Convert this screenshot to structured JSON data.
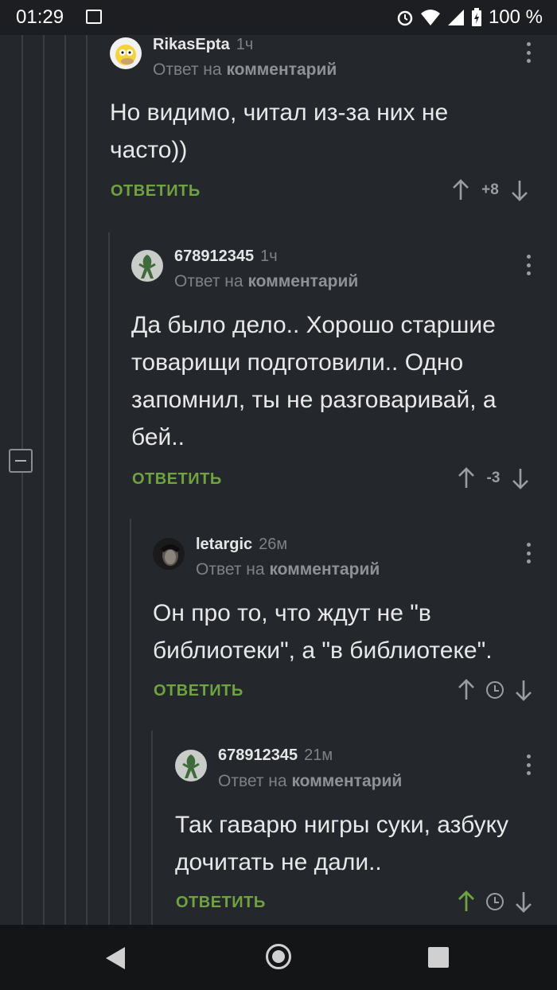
{
  "status_bar": {
    "time": "01:29",
    "battery": "100 %"
  },
  "comments": [
    {
      "username": "RikasEpta",
      "time": "1ч",
      "reply_prefix": "Ответ на",
      "reply_target": "комментарий",
      "text": "Но видимо, читал из-за них не часто))",
      "reply_label": "ОТВЕТИТЬ",
      "score": "+8"
    },
    {
      "username": "678912345",
      "time": "1ч",
      "reply_prefix": "Ответ на",
      "reply_target": "комментарий",
      "text": "Да было дело.. Хорошо старшие товарищи подготовили.. Одно запомнил, ты не разговаривай, а бей..",
      "reply_label": "ОТВЕТИТЬ",
      "score": "-3"
    },
    {
      "username": "letargic",
      "time": "26м",
      "reply_prefix": "Ответ на",
      "reply_target": "комментарий",
      "text": "Он про то, что ждут не \"в библиотеки\", а \"в библиотеке\".",
      "reply_label": "ОТВЕТИТЬ"
    },
    {
      "username": "678912345",
      "time": "21м",
      "reply_prefix": "Ответ на",
      "reply_target": "комментарий",
      "text": "Так гаварю нигры суки, азбуку дочитать не дали..",
      "reply_label": "ОТВЕТИТЬ",
      "upvoted": true
    }
  ],
  "colors": {
    "background": "#24272b",
    "accent_green": "#6fa341",
    "muted": "#7e8186"
  }
}
